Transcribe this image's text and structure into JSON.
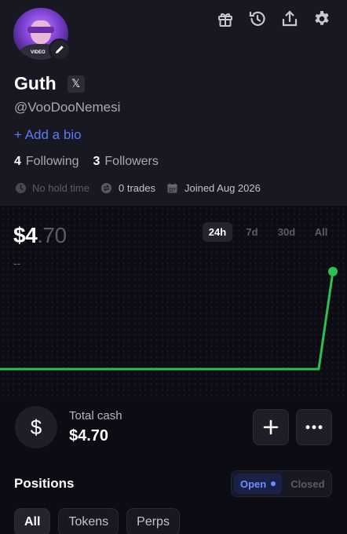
{
  "profile": {
    "avatar_text": "VIDEO",
    "name": "Guth",
    "x_badge": "𝕏",
    "handle": "@VooDooNemesi",
    "add_bio": "+ Add a bio",
    "following_count": "4",
    "following_label": "Following",
    "followers_count": "3",
    "followers_label": "Followers",
    "hold_time": "No hold time",
    "trades": "0 trades",
    "joined": "Joined Aug 2026"
  },
  "top_icons": [
    "gift-icon",
    "history-icon",
    "share-icon",
    "gear-icon"
  ],
  "portfolio": {
    "balance_whole": "$4",
    "balance_decimal": ".70",
    "delta": "--",
    "ranges": [
      "24h",
      "7d",
      "30d",
      "All"
    ],
    "active_range": "24h",
    "line_color": "#2ec04f"
  },
  "chart_data": {
    "type": "line",
    "x": [
      0,
      1,
      2,
      3,
      4,
      5,
      6,
      7,
      8,
      9,
      10,
      11,
      12,
      13,
      14,
      15,
      16,
      17,
      18,
      19,
      20,
      21,
      22,
      23,
      24
    ],
    "values": [
      0,
      0,
      0,
      0,
      0,
      0,
      0,
      0,
      0,
      0,
      0,
      0,
      0,
      0,
      0,
      0,
      0,
      0,
      0,
      0,
      0,
      0,
      0,
      0,
      4.7
    ],
    "ylim": [
      0,
      5.6
    ]
  },
  "cash": {
    "icon": "$",
    "label": "Total cash",
    "value": "$4.70"
  },
  "positions": {
    "title": "Positions",
    "open_label": "Open",
    "closed_label": "Closed",
    "filters": [
      "All",
      "Tokens",
      "Perps"
    ]
  }
}
